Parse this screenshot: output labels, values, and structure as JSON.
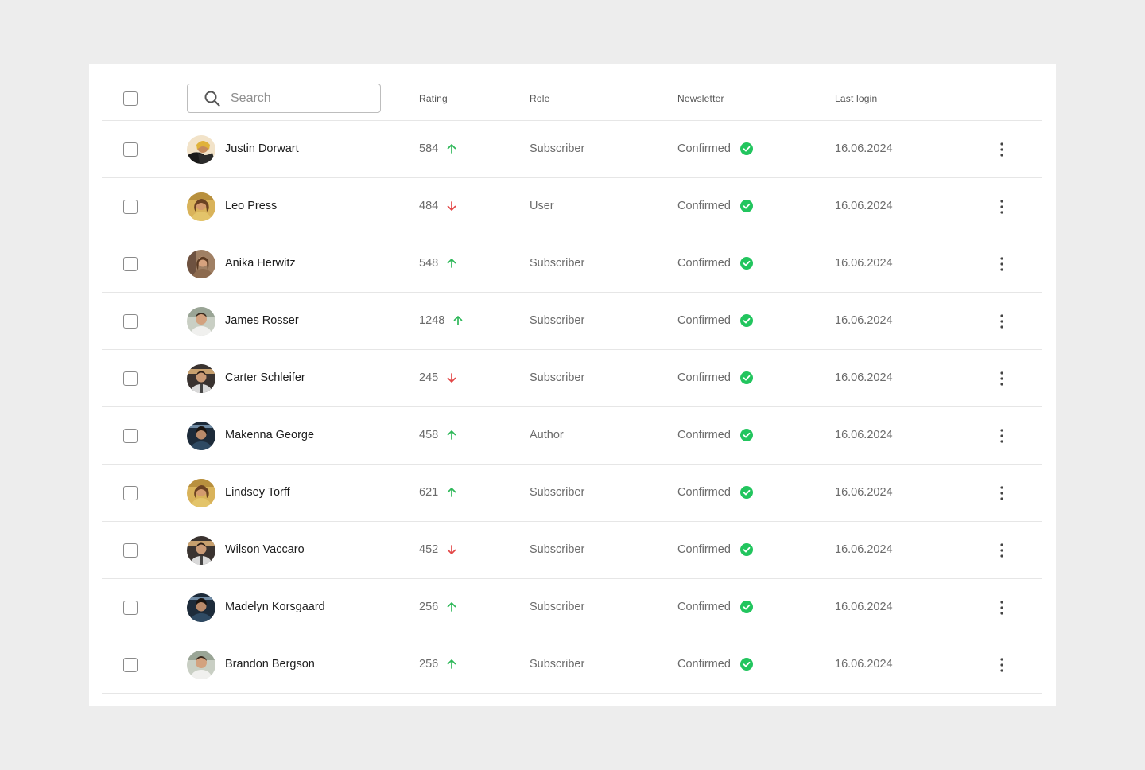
{
  "search": {
    "placeholder": "Search"
  },
  "columns": {
    "rating": "Rating",
    "role": "Role",
    "newsletter": "Newsletter",
    "last_login": "Last login"
  },
  "colors": {
    "up": "#2fb85a",
    "down": "#e34848",
    "confirmed": "#22c55e"
  },
  "rows": [
    {
      "name": "Justin Dorwart",
      "rating": "584",
      "trend": "up",
      "role": "Subscriber",
      "newsletter": "Confirmed",
      "last_login": "16.06.2024",
      "avatar": "avatar-1"
    },
    {
      "name": "Leo Press",
      "rating": "484",
      "trend": "down",
      "role": "User",
      "newsletter": "Confirmed",
      "last_login": "16.06.2024",
      "avatar": "avatar-2"
    },
    {
      "name": "Anika Herwitz",
      "rating": "548",
      "trend": "up",
      "role": "Subscriber",
      "newsletter": "Confirmed",
      "last_login": "16.06.2024",
      "avatar": "avatar-3"
    },
    {
      "name": "James Rosser",
      "rating": "1248",
      "trend": "up",
      "role": "Subscriber",
      "newsletter": "Confirmed",
      "last_login": "16.06.2024",
      "avatar": "avatar-4"
    },
    {
      "name": "Carter Schleifer",
      "rating": "245",
      "trend": "down",
      "role": "Subscriber",
      "newsletter": "Confirmed",
      "last_login": "16.06.2024",
      "avatar": "avatar-5"
    },
    {
      "name": "Makenna George",
      "rating": "458",
      "trend": "up",
      "role": "Author",
      "newsletter": "Confirmed",
      "last_login": "16.06.2024",
      "avatar": "avatar-6"
    },
    {
      "name": "Lindsey Torff",
      "rating": "621",
      "trend": "up",
      "role": "Subscriber",
      "newsletter": "Confirmed",
      "last_login": "16.06.2024",
      "avatar": "avatar-2"
    },
    {
      "name": "Wilson Vaccaro",
      "rating": "452",
      "trend": "down",
      "role": "Subscriber",
      "newsletter": "Confirmed",
      "last_login": "16.06.2024",
      "avatar": "avatar-5"
    },
    {
      "name": "Madelyn Korsgaard",
      "rating": "256",
      "trend": "up",
      "role": "Subscriber",
      "newsletter": "Confirmed",
      "last_login": "16.06.2024",
      "avatar": "avatar-6"
    },
    {
      "name": "Brandon Bergson",
      "rating": "256",
      "trend": "up",
      "role": "Subscriber",
      "newsletter": "Confirmed",
      "last_login": "16.06.2024",
      "avatar": "avatar-4"
    }
  ]
}
